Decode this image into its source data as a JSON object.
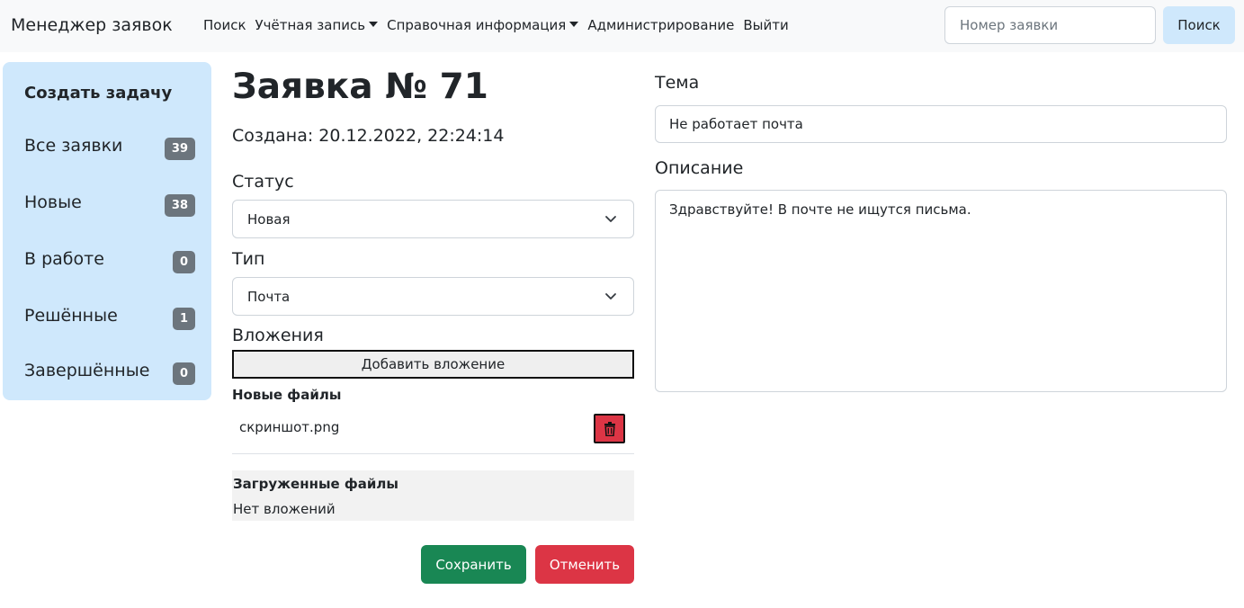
{
  "navbar": {
    "brand": "Менеджер заявок",
    "links": {
      "search": "Поиск",
      "account": "Учётная запись",
      "reference": "Справочная информация",
      "admin": "Администрирование",
      "logout": "Выйти"
    },
    "search_placeholder": "Номер заявки",
    "search_button": "Поиск"
  },
  "sidebar": {
    "create": "Создать задачу",
    "items": [
      {
        "label": "Все заявки",
        "count": "39"
      },
      {
        "label": "Новые",
        "count": "38"
      },
      {
        "label": "В работе",
        "count": "0"
      },
      {
        "label": "Решённые",
        "count": "1"
      },
      {
        "label": "Завершённые",
        "count": "0"
      }
    ]
  },
  "ticket": {
    "title": "Заявка № 71",
    "created": "Создана: 20.12.2022, 22:24:14",
    "status_label": "Статус",
    "status_value": "Новая",
    "type_label": "Тип",
    "type_value": "Почта",
    "attachments_label": "Вложения",
    "add_attachment": "Добавить вложение",
    "new_files_title": "Новые файлы",
    "new_files": [
      "скриншот.png"
    ],
    "uploaded_title": "Загруженные файлы",
    "uploaded_empty": "Нет вложений",
    "save": "Сохранить",
    "cancel": "Отменить",
    "topic_label": "Тема",
    "topic_value": "Не работает почта",
    "description_label": "Описание",
    "description_value": "Здравствуйте! В почте не ищутся письма."
  },
  "colors": {
    "accent_light": "#cfe8fc",
    "badge": "#6c757d",
    "success": "#198754",
    "danger": "#dc3545"
  }
}
